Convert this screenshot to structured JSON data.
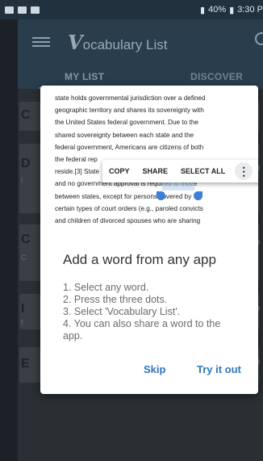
{
  "status_bar": {
    "battery": "40%",
    "time": "3:30 P"
  },
  "app_bar": {
    "title_initial": "V",
    "title_rest": "ocabulary List"
  },
  "tabs": [
    {
      "label": "MY LIST"
    },
    {
      "label": "DISCOVER"
    }
  ],
  "background_cards": [
    {
      "word": "C",
      "definition": ""
    },
    {
      "word": "D",
      "definition": "i"
    },
    {
      "word": "C",
      "definition": "C"
    },
    {
      "word": "I",
      "definition": "t"
    },
    {
      "word": "E",
      "definition": ""
    }
  ],
  "article_excerpt": {
    "lines": [
      "state holds governmental jurisdiction over a defined",
      "geographic territory and shares its sovereignty with",
      "the United States federal government. Due to the",
      "shared sovereignty between each state and the",
      "federal government, Americans are citizens of both",
      "the federal rep",
      "reside.[3] State",
      "and no government approval is required to move",
      "between states, except for persons covered by",
      "certain types of court orders (e.g., paroled convicts",
      "and children of divorced spouses who are sharing"
    ],
    "selected_word": "required"
  },
  "text_toolbar": {
    "copy_label": "COPY",
    "share_label": "SHARE",
    "select_all_label": "SELECT ALL",
    "more_label": "⋮"
  },
  "dialog": {
    "title": "Add a word from any app",
    "steps": [
      "1. Select any word.",
      "2. Press the three dots.",
      "3. Select 'Vocabulary List'.",
      "4. You can also share a word to the",
      "app."
    ],
    "skip_label": "Skip",
    "try_label": "Try it out"
  }
}
